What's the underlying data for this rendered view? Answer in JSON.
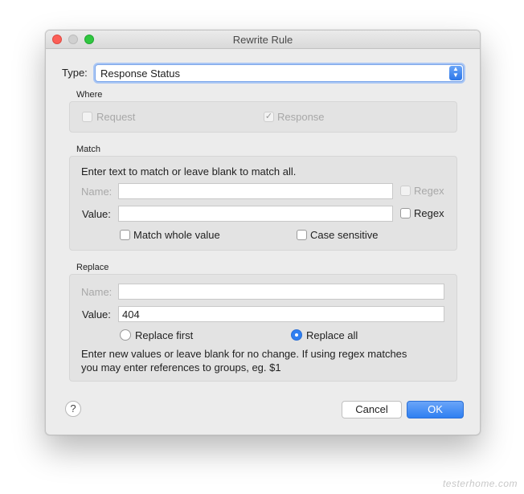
{
  "window": {
    "title": "Rewrite Rule"
  },
  "type": {
    "label": "Type:",
    "value": "Response Status"
  },
  "where": {
    "title": "Where",
    "request": {
      "label": "Request",
      "checked": false,
      "enabled": false
    },
    "response": {
      "label": "Response",
      "checked": true,
      "enabled": false
    }
  },
  "match": {
    "title": "Match",
    "instructions": "Enter text to match or leave blank to match all.",
    "name_label": "Name:",
    "name_value": "",
    "name_regex_label": "Regex",
    "value_label": "Value:",
    "value_value": "",
    "value_regex_label": "Regex",
    "whole_value_label": "Match whole value",
    "case_sensitive_label": "Case sensitive"
  },
  "replace": {
    "title": "Replace",
    "name_label": "Name:",
    "name_value": "",
    "value_label": "Value:",
    "value_value": "404",
    "replace_first_label": "Replace first",
    "replace_all_label": "Replace all",
    "selected": "Replace all",
    "note_line1": "Enter new values or leave blank for no change. If using regex matches",
    "note_line2": "you may enter references to groups, eg. $1"
  },
  "buttons": {
    "help": "?",
    "cancel": "Cancel",
    "ok": "OK"
  },
  "watermark": "testerhome.com",
  "colors": {
    "accent": "#2f7ff1",
    "close": "#fc5f57",
    "zoom": "#30c740"
  }
}
